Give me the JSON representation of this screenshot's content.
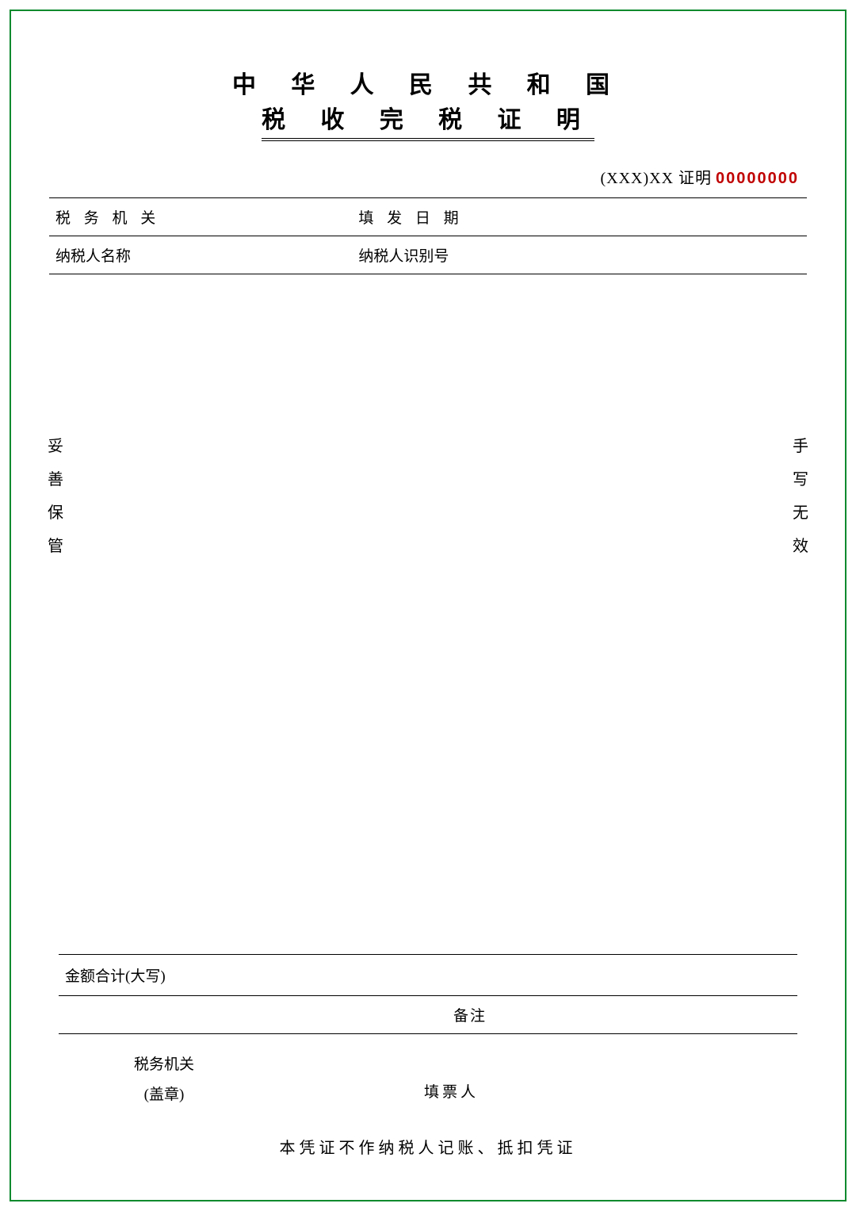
{
  "title": {
    "line1": "中 华 人 民 共 和 国",
    "line2": "税  收  完  税  证  明"
  },
  "cert": {
    "prefix": "(XXX)XX 证明",
    "number": "00000000"
  },
  "fields": {
    "tax_authority_label": "税 务 机 关",
    "issue_date_label": "填 发 日 期",
    "taxpayer_name_label": "纳税人名称",
    "taxpayer_id_label": "纳税人识别号",
    "amount_label": "金额合计(大写)",
    "remark_label": "备注",
    "seal_line1": "税务机关",
    "seal_line2": "(盖章)",
    "issuer_label": "填票人"
  },
  "side_notes": {
    "left": [
      "妥",
      "善",
      "保",
      "管"
    ],
    "right": [
      "手",
      "写",
      "无",
      "效"
    ]
  },
  "footer": "本凭证不作纳税人记账、抵扣凭证"
}
